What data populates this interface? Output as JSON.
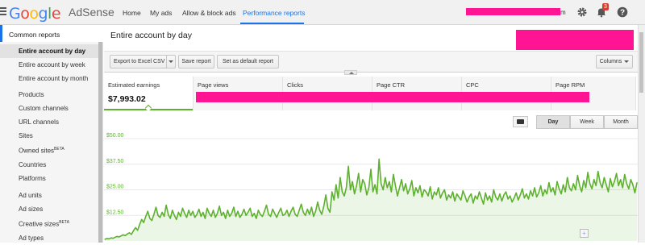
{
  "header": {
    "logo_google": "Google",
    "logo_product": "AdSense",
    "nav": [
      "Home",
      "My ads",
      "Allow & block ads",
      "Performance reports"
    ],
    "active_nav": "Performance reports",
    "account_suffix": "m",
    "notification_count": "3",
    "icons": [
      "gear-icon",
      "bell-icon",
      "help-icon"
    ]
  },
  "sidebar": {
    "section_title": "Common reports",
    "items": [
      {
        "label": "Entire account by day",
        "sup": ""
      },
      {
        "label": "Entire account by week",
        "sup": ""
      },
      {
        "label": "Entire account by month",
        "sup": ""
      },
      {
        "label": "Products",
        "sup": ""
      },
      {
        "label": "Custom channels",
        "sup": ""
      },
      {
        "label": "URL channels",
        "sup": ""
      },
      {
        "label": "Sites",
        "sup": ""
      },
      {
        "label": "Owned sites",
        "sup": "BETA"
      },
      {
        "label": "Countries",
        "sup": ""
      },
      {
        "label": "Platforms",
        "sup": ""
      },
      {
        "label": "Ad units",
        "sup": ""
      },
      {
        "label": "Ad sizes",
        "sup": ""
      },
      {
        "label": "Creative sizes",
        "sup": "BETA"
      },
      {
        "label": "Ad types",
        "sup": ""
      }
    ]
  },
  "main": {
    "title": "Entire account by day",
    "toolbar": {
      "export_label": "Export to Excel CSV",
      "save_label": "Save report",
      "default_label": "Set as default report",
      "columns_label": "Columns"
    },
    "metrics": [
      {
        "label": "Estimated earnings",
        "value": "$7,993.02"
      },
      {
        "label": "Page views",
        "value": ""
      },
      {
        "label": "Clicks",
        "value": ""
      },
      {
        "label": "Page CTR",
        "value": ""
      },
      {
        "label": "CPC",
        "value": ""
      },
      {
        "label": "Page RPM",
        "value": ""
      }
    ],
    "granularity": [
      "Day",
      "Week",
      "Month"
    ],
    "active_granularity": "Day"
  },
  "colors": {
    "accent_blue": "#1a73e8",
    "series_green": "#5db12e",
    "redaction": "#ff1493"
  },
  "chart_data": {
    "type": "area",
    "y_tick_labels": [
      "$50.00",
      "$37.50",
      "$25.00",
      "$12.50"
    ],
    "ylim": [
      0,
      55
    ],
    "grid": true,
    "series": [
      {
        "values": [
          0.8,
          1.2,
          1.0,
          1.5,
          1.3,
          1.8,
          2.2,
          2.0,
          2.5,
          3.0,
          2.6,
          3.4,
          4.0,
          3.2,
          5.0,
          6.5,
          5.2,
          8.0,
          10.5,
          9.0,
          12.0,
          14.5,
          11.0,
          10.0,
          13.0,
          16.5,
          12.5,
          11.5,
          14.0,
          12.0,
          17.5,
          13.0,
          11.0,
          15.0,
          12.5,
          10.5,
          14.0,
          12.0,
          16.0,
          13.5,
          11.5,
          15.0,
          12.5,
          14.5,
          11.5,
          13.0,
          15.5,
          12.0,
          14.0,
          11.0,
          16.0,
          13.5,
          12.0,
          15.0,
          11.5,
          13.5,
          17.0,
          12.5,
          14.0,
          11.0,
          15.0,
          12.0,
          13.5,
          16.5,
          12.0,
          14.5,
          11.5,
          13.0,
          15.5,
          12.5,
          14.0,
          16.0,
          12.0,
          13.5,
          11.0,
          15.0,
          13.0,
          12.0,
          14.5,
          17.5,
          13.0,
          12.0,
          15.5,
          13.5,
          11.5,
          14.0,
          16.0,
          12.5,
          13.0,
          15.0,
          12.0,
          14.5,
          16.5,
          13.0,
          12.0,
          15.0,
          18.0,
          14.0,
          12.5,
          15.5,
          13.0,
          16.5,
          12.0,
          14.5,
          19.0,
          15.0,
          13.0,
          17.0,
          22.5,
          16.0,
          14.0,
          24.0,
          20.0,
          27.5,
          21.0,
          31.0,
          24.0,
          22.0,
          26.0,
          36.5,
          25.0,
          29.0,
          23.0,
          27.0,
          33.0,
          24.0,
          30.0,
          28.0,
          22.5,
          26.0,
          35.0,
          24.0,
          27.5,
          23.0,
          40.0,
          28.0,
          25.0,
          31.0,
          26.0,
          29.0,
          24.0,
          32.5,
          27.0,
          22.0,
          26.0,
          30.0,
          24.5,
          28.0,
          23.0,
          25.5,
          29.5,
          22.0,
          26.0,
          23.5,
          27.0,
          21.5,
          25.0,
          24.0,
          22.0,
          26.5,
          20.5,
          24.0,
          22.5,
          26.0,
          21.0,
          23.5,
          25.0,
          20.0,
          22.5,
          21.0,
          24.0,
          19.5,
          23.0,
          21.5,
          20.0,
          24.5,
          22.0,
          19.0,
          21.5,
          23.0,
          18.5,
          22.0,
          20.5,
          24.0,
          21.0,
          18.0,
          23.5,
          20.0,
          22.0,
          19.0,
          25.0,
          21.5,
          20.0,
          23.0,
          19.5,
          22.5,
          24.0,
          20.5,
          22.0,
          19.0,
          21.0,
          23.5,
          20.0,
          22.5,
          25.5,
          21.0,
          23.0,
          20.5,
          24.5,
          22.0,
          26.0,
          21.5,
          23.5,
          27.0,
          22.0,
          25.0,
          23.0,
          28.5,
          24.0,
          26.0,
          22.5,
          29.0,
          25.5,
          23.0,
          27.5,
          24.0,
          31.0,
          26.0,
          24.5,
          28.0,
          25.0,
          32.0,
          27.0,
          24.0,
          29.5,
          26.0,
          33.5,
          28.0,
          25.5,
          30.0,
          27.0,
          34.0,
          28.5,
          26.0,
          31.0,
          27.5,
          24.0,
          30.5,
          26.5,
          29.0,
          33.0,
          27.0,
          30.0,
          26.0,
          32.5,
          28.0,
          25.5,
          30.0,
          27.5,
          23.5,
          28.5
        ]
      }
    ]
  }
}
